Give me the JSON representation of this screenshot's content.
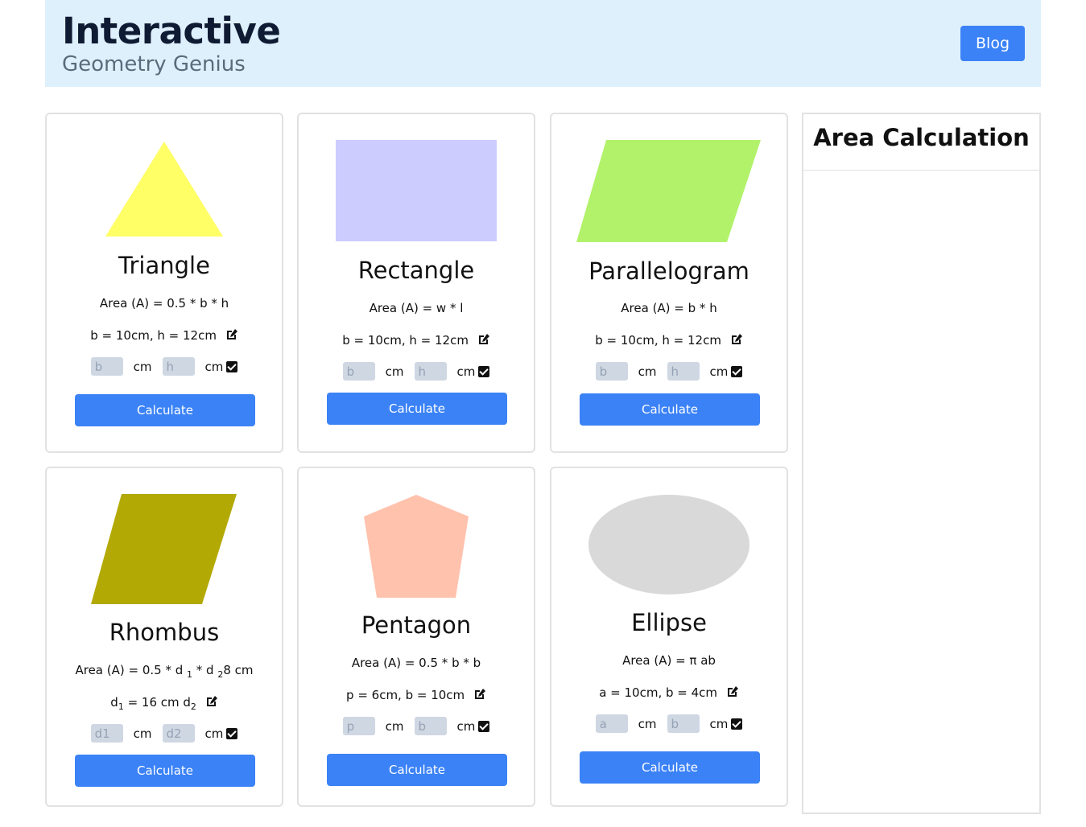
{
  "header": {
    "title": "Interactive",
    "subtitle": "Geometry Genius",
    "blog_label": "Blog"
  },
  "cards": {
    "triangle": {
      "title": "Triangle",
      "formula": "Area (A) = 0.5 * b * h",
      "params": "b = 10cm, h = 12cm",
      "input1_placeholder": "b",
      "input2_placeholder": "h",
      "unit": "cm",
      "button": "Calculate",
      "color": "#ffff66"
    },
    "rectangle": {
      "title": "Rectangle",
      "formula": "Area (A) = w * l",
      "params": "b = 10cm, h = 12cm",
      "input1_placeholder": "b",
      "input2_placeholder": "h",
      "unit": "cm",
      "button": "Calculate",
      "color": "#ccccff"
    },
    "parallelogram": {
      "title": "Parallelogram",
      "formula": "Area (A) = b * h",
      "params": "b = 10cm, h = 12cm",
      "input1_placeholder": "b",
      "input2_placeholder": "h",
      "unit": "cm",
      "button": "Calculate",
      "color": "#b2f26b"
    },
    "rhombus": {
      "title": "Rhombus",
      "formula_prefix": "Area (A) = 0.5 * d ",
      "formula_sub1": "1",
      "formula_mid": " * d ",
      "formula_sub2": "2",
      "formula_suffix": "8 cm",
      "params_d1": "d",
      "params_sub1": "1",
      "params_mid": " = 16 cm d",
      "params_sub2": "2",
      "input1_placeholder": "d1",
      "input2_placeholder": "d2",
      "unit": "cm",
      "button": "Calculate",
      "color": "#b3a905"
    },
    "pentagon": {
      "title": "Pentagon",
      "formula": "Area (A) = 0.5 * b * b",
      "params": "p = 6cm, b = 10cm",
      "input1_placeholder": "p",
      "input2_placeholder": "b",
      "unit": "cm",
      "button": "Calculate",
      "color": "#ffc2ad"
    },
    "ellipse": {
      "title": "Ellipse",
      "formula": "Area (A) = π ab",
      "params": "a = 10cm, b = 4cm",
      "input1_placeholder": "a",
      "input2_placeholder": "b",
      "unit": "cm",
      "button": "Calculate",
      "color": "#d9d9d9"
    }
  },
  "sidebar": {
    "title": "Area Calculation"
  }
}
